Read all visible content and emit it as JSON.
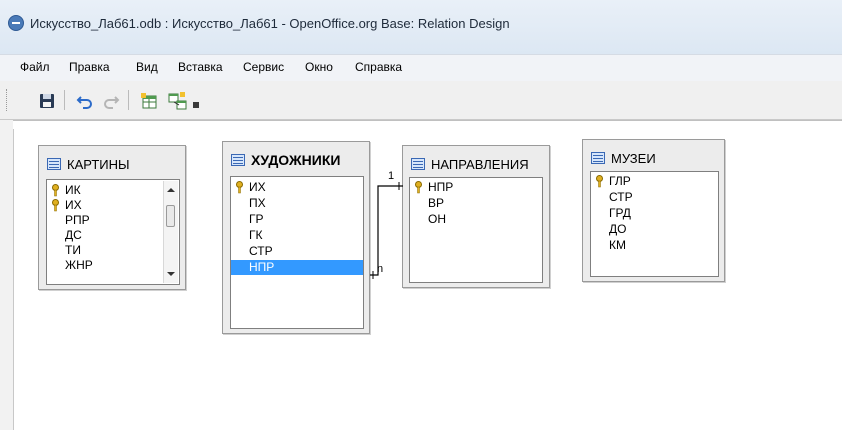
{
  "window": {
    "title": "Искусство_Лаб61.odb : Искусство_Лаб61 - OpenOffice.org Base: Relation Design"
  },
  "menu": [
    "Файл",
    "Правка",
    "Вид",
    "Вставка",
    "Сервис",
    "Окно",
    "Справка"
  ],
  "toolbar": {
    "buttons": [
      "save-icon",
      "undo-icon",
      "redo-icon",
      "add-table-icon",
      "new-relation-icon"
    ]
  },
  "tables": [
    {
      "name": "КАРТИНЫ",
      "bold": false,
      "fields": [
        {
          "name": "ИК",
          "key": true
        },
        {
          "name": "ИХ",
          "key": true
        },
        {
          "name": "РПР",
          "key": false
        },
        {
          "name": "ДС",
          "key": false
        },
        {
          "name": "ТИ",
          "key": false
        },
        {
          "name": "ЖНР",
          "key": false
        }
      ],
      "scrollbar": true
    },
    {
      "name": "ХУДОЖНИКИ",
      "bold": true,
      "fields": [
        {
          "name": "ИХ",
          "key": true
        },
        {
          "name": "ПХ",
          "key": false
        },
        {
          "name": "ГР",
          "key": false
        },
        {
          "name": "ГК",
          "key": false
        },
        {
          "name": "СТР",
          "key": false
        },
        {
          "name": "НПР",
          "key": false,
          "selected": true
        }
      ],
      "scrollbar": false
    },
    {
      "name": "НАПРАВЛЕНИЯ",
      "bold": false,
      "fields": [
        {
          "name": "НПР",
          "key": true
        },
        {
          "name": "ВР",
          "key": false
        },
        {
          "name": "ОН",
          "key": false
        }
      ],
      "scrollbar": false
    },
    {
      "name": "МУЗЕИ",
      "bold": false,
      "fields": [
        {
          "name": "ГЛР",
          "key": true
        },
        {
          "name": "СТР",
          "key": false
        },
        {
          "name": "ГРД",
          "key": false
        },
        {
          "name": "ДО",
          "key": false
        },
        {
          "name": "КМ",
          "key": false
        }
      ],
      "scrollbar": false
    }
  ],
  "relation": {
    "from_table": "ХУДОЖНИКИ",
    "from_field": "НПР",
    "to_table": "НАПРАВЛЕНИЯ",
    "to_field": "НПР",
    "card_one": "1",
    "card_many": "n"
  }
}
